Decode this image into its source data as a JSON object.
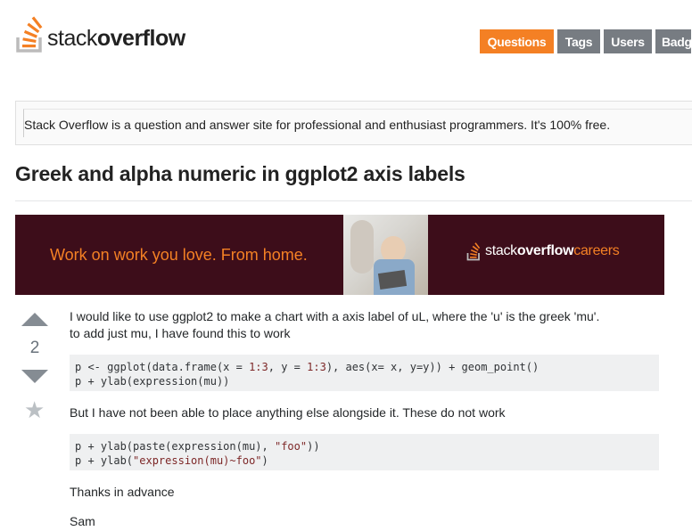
{
  "header": {
    "logo_stack": "stack",
    "logo_overflow": "overflow",
    "nav": [
      {
        "label": "Questions",
        "active": true
      },
      {
        "label": "Tags",
        "active": false
      },
      {
        "label": "Users",
        "active": false
      },
      {
        "label": "Badg",
        "active": false
      }
    ]
  },
  "intro": "Stack Overflow is a question and answer site for professional and enthusiast programmers. It's 100% free.",
  "question": {
    "title": "Greek and alpha numeric in ggplot2 axis labels",
    "votes": "2",
    "paragraphs": [
      "I would like to use ggplot2 to make a chart with a axis label of uL, where the 'u' is the greek 'mu'.",
      "to add just mu, I have found this to work",
      "But I have not been able to place anything else alongside it. These do not work",
      "Thanks in advance",
      "Sam"
    ],
    "code1": {
      "line1_pre": "p <- ggplot(data.frame(x = ",
      "line1_n1": "1:3",
      "line1_mid": ", y = ",
      "line1_n2": "1:3",
      "line1_post": "), aes(x= x, y=y)) + geom_point()",
      "line2": "p + ylab(expression(mu))"
    },
    "code2": {
      "line1_pre": "p + ylab(paste(expression(mu), ",
      "line1_str": "\"foo\"",
      "line1_post": "))",
      "line2_pre": "p + ylab(",
      "line2_str": "\"expression(mu)~foo\"",
      "line2_post": ")"
    }
  },
  "ad": {
    "tagline": "Work on work you love. From home.",
    "brand_stack": "stack",
    "brand_overflow": "overflow",
    "brand_careers": "careers"
  },
  "colors": {
    "accent": "#f48024",
    "ad_background": "#3d0d1a",
    "nav_inactive": "#777c82"
  }
}
